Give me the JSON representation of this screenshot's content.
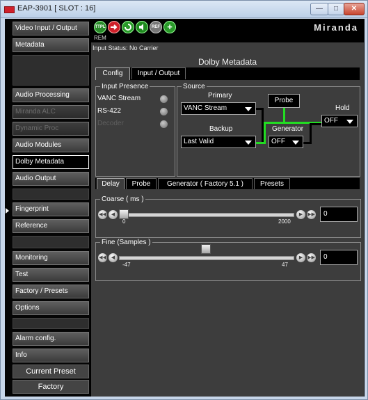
{
  "window": {
    "title": "EAP-3901 [ SLOT : 16]",
    "minimize_glyph": "—",
    "maximize_glyph": "□",
    "close_glyph": "✕"
  },
  "sidebar": {
    "items": [
      {
        "label": "Video Input / Output",
        "state": "normal"
      },
      {
        "label": "Metadata",
        "state": "normal"
      },
      {
        "label": "Audio Processing",
        "state": "normal"
      },
      {
        "label": "Miranda ALC",
        "state": "disabled"
      },
      {
        "label": "Dynamic Proc",
        "state": "disabled"
      },
      {
        "label": "Audio Modules",
        "state": "normal"
      },
      {
        "label": "Dolby Metadata",
        "state": "selected"
      },
      {
        "label": "Audio Output",
        "state": "normal"
      },
      {
        "label": "Fingerprint",
        "state": "normal"
      },
      {
        "label": "Reference",
        "state": "normal"
      },
      {
        "label": "Monitoring",
        "state": "normal"
      },
      {
        "label": "Test",
        "state": "normal"
      },
      {
        "label": "Factory / Presets",
        "state": "normal"
      },
      {
        "label": "Options",
        "state": "normal"
      },
      {
        "label": "Alarm config.",
        "state": "normal"
      },
      {
        "label": "Info",
        "state": "normal"
      }
    ],
    "current_preset_label": "Current Preset",
    "current_preset_value": "Factory"
  },
  "toolbar": {
    "icons": [
      {
        "name": "ttpl-icon",
        "text": "TTPL",
        "color": "#2a8a2a"
      },
      {
        "name": "arrow-icon",
        "text": "",
        "color": "#d0202a"
      },
      {
        "name": "refresh-icon",
        "text": "",
        "color": "#2a9a2a"
      },
      {
        "name": "audio-icon",
        "text": "",
        "color": "#1e8a1e"
      },
      {
        "name": "ref-icon",
        "text": "REF",
        "color": "#777777"
      },
      {
        "name": "add-icon",
        "text": "+",
        "color": "#2a9a2a"
      }
    ],
    "rem_label": "REM",
    "brand": "Miranda"
  },
  "status": "Input Status: No Carrier",
  "section_title": "Dolby Metadata",
  "top_tabs": [
    "Config",
    "Input / Output"
  ],
  "input_presence": {
    "title": "Input Presence",
    "rows": [
      {
        "label": "VANC Stream",
        "dim": false
      },
      {
        "label": "RS-422",
        "dim": false
      },
      {
        "label": "Decoder",
        "dim": true
      }
    ]
  },
  "source": {
    "title": "Source",
    "primary_label": "Primary",
    "primary_value": "VANC Stream",
    "backup_label": "Backup",
    "backup_value": "Last Valid",
    "probe_label": "Probe",
    "generator_label": "Generator",
    "generator_value": "OFF",
    "hold_label": "Hold",
    "hold_value": "OFF",
    "active_wire_color": "#22dd22"
  },
  "bottom_tabs": [
    "Delay",
    "Probe",
    "Generator ( Factory 5.1 )",
    "Presets"
  ],
  "coarse": {
    "title": "Coarse ( ms )",
    "min": "0",
    "max": "2000",
    "value": "0",
    "level": 0.0
  },
  "fine": {
    "title": "Fine (Samples )",
    "min": "-47",
    "max": "47",
    "value": "0",
    "level": 0.5
  }
}
